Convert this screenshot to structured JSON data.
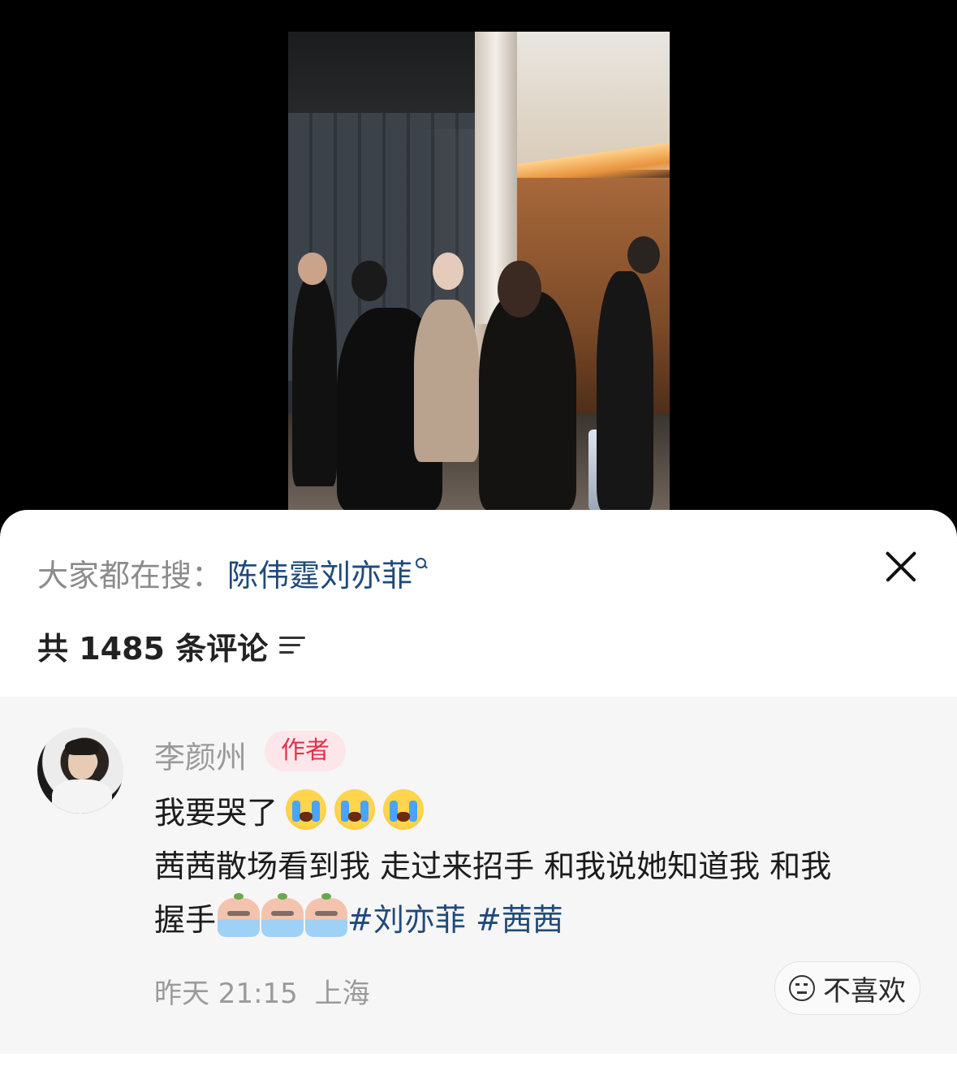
{
  "search": {
    "prefix": "大家都在搜：",
    "term": "陈伟霆刘亦菲"
  },
  "comments_header": {
    "count_text": "共 1485 条评论"
  },
  "comment": {
    "author": "李颜州",
    "badge": "作者",
    "line1": "我要哭了",
    "line2": "茜茜散场看到我 走过来招手 和我说她知道我 和我",
    "line3_text": "握手",
    "hashtag1": "#刘亦菲",
    "hashtag2": "#茜茜",
    "time": "昨天 21:15",
    "location": "上海",
    "dislike_label": "不喜欢"
  },
  "icons": [
    "search-icon",
    "close-icon",
    "sort-icon",
    "crying-emoji",
    "crying-sticker",
    "meh-face-icon"
  ],
  "colors": {
    "link": "#1f4a7a",
    "badge_bg": "#fde6ea",
    "badge_text": "#e0334d",
    "muted": "#9a9a9a"
  }
}
